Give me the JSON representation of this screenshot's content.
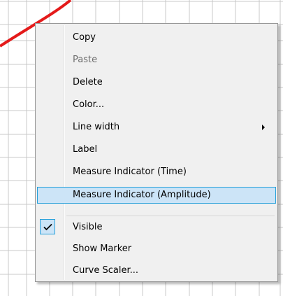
{
  "colors": {
    "curve": "#e41a1a",
    "grid": "#c8c8c8",
    "highlight_bg": "#cce4f7",
    "highlight_border": "#26a0da"
  },
  "context_menu": {
    "items": [
      {
        "label": "Copy"
      },
      {
        "label": "Paste",
        "disabled": true
      },
      {
        "label": "Delete"
      },
      {
        "label": "Color..."
      },
      {
        "label": "Line width",
        "submenu_icon": "chevron-right-icon"
      },
      {
        "label": "Label"
      },
      {
        "label": "Measure Indicator (Time)"
      },
      {
        "label": "Measure Indicator (Amplitude)",
        "highlighted": true
      },
      {
        "label": "Visible",
        "checked": true,
        "check_icon": "checkmark-icon"
      },
      {
        "label": "Show Marker"
      },
      {
        "label": "Curve Scaler..."
      }
    ]
  }
}
